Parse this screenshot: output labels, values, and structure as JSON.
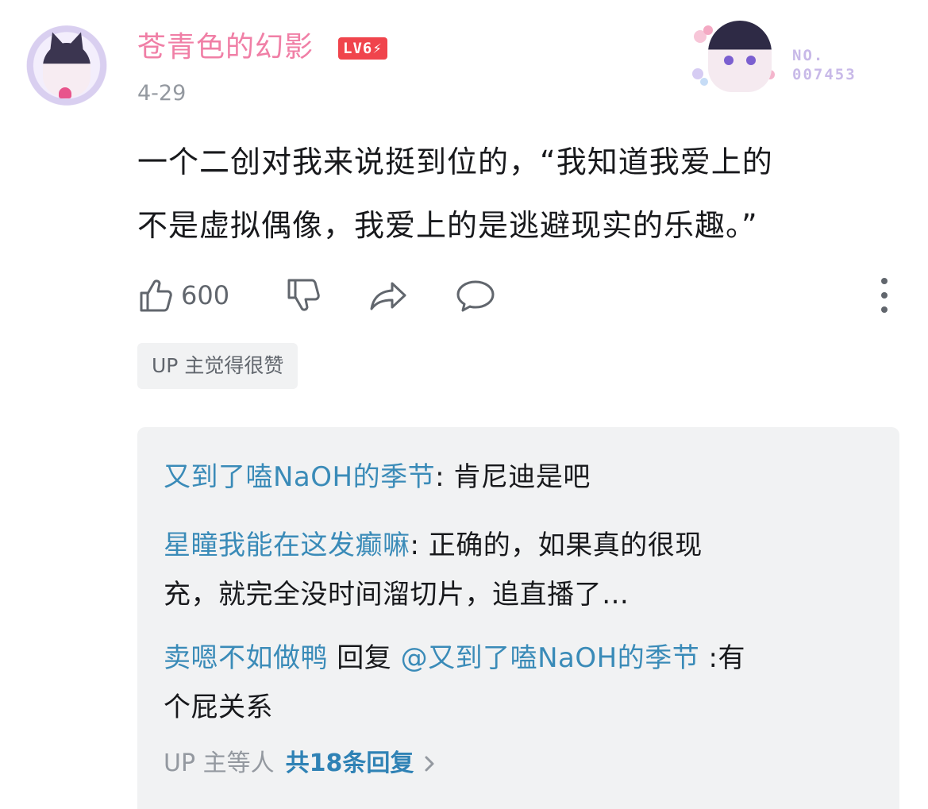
{
  "comment": {
    "username": "苍青色的幻影",
    "level": "LV6⚡",
    "date": "4-29",
    "fan_badge": {
      "no_label": "NO.",
      "number": "007453"
    },
    "content_lines": [
      "一个二创对我来说挺到位的，“我知道我爱上的",
      "不是虚拟偶像，我爱上的是逃避现实的乐趣。”"
    ],
    "like_count": "600",
    "up_tag": "UP 主觉得很赞"
  },
  "replies": [
    {
      "name": "又到了嗑NaOH的季节",
      "sep": ": ",
      "text_lines": [
        "肯尼迪是吧"
      ]
    },
    {
      "name": "星瞳我能在这发癫嘛",
      "sep": ": ",
      "text_lines": [
        "正确的，如果真的很现",
        "充，就完全没时间溜切片，追直播了…"
      ]
    },
    {
      "name": "卖嗯不如做鸭",
      "reply_word": " 回复 ",
      "mention": "@又到了嗑NaOH的季节",
      "sep": " :",
      "text_lines": [
        "有",
        "个屁关系"
      ]
    }
  ],
  "reply_footer": {
    "prefix": "UP 主等人",
    "count_label": "共18条回复"
  },
  "colors": {
    "username": "#f07fa6",
    "link": "#3a8bb8",
    "level_bg": "#f0444c",
    "panel": "#f1f2f3"
  },
  "icons": [
    "thumbs-up-icon",
    "thumbs-down-icon",
    "share-icon",
    "comment-icon",
    "more-vertical-icon",
    "chevron-right-icon"
  ]
}
